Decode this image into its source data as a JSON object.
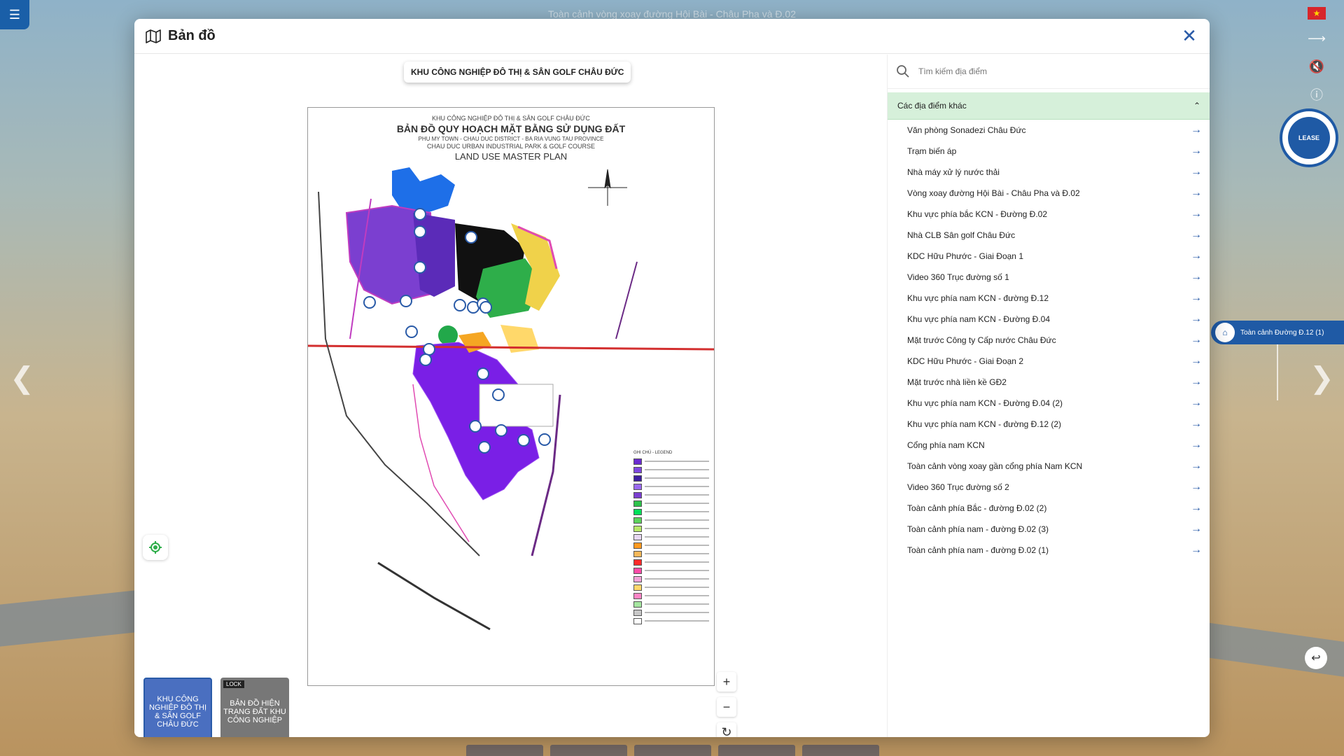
{
  "background": {
    "caption": "Toàn cảnh vòng xoay đường Hội Bài - Châu Pha và Đ.02",
    "hotspot_label": "Toàn cảnh Đường Đ.12 (1)",
    "badge_text": "LEASE"
  },
  "modal": {
    "title": "Bản đồ",
    "map_pill": "KHU CÔNG NGHIỆP ĐÔ THỊ & SÂN GOLF CHÂU ĐỨC"
  },
  "plan": {
    "line1": "KHU CÔNG NGHIỆP ĐÔ THỊ & SÂN GOLF CHÂU ĐỨC",
    "line2": "BẢN ĐỒ QUY HOẠCH MẶT BẰNG SỬ DỤNG ĐẤT",
    "line3": "PHU MY TOWN - CHAU DUC DISTRICT - BA RIA VUNG TAU PROVINCE",
    "line4": "CHAU DUC URBAN INDUSTRIAL PARK & GOLF COURSE",
    "line5": "LAND USE MASTER PLAN",
    "legend_title": "GHI CHÚ - LEGEND",
    "legend_colors": [
      "#6a2bd1",
      "#7e47e0",
      "#3d1ea0",
      "#9a6af0",
      "#7b3fd0",
      "#2ec24a",
      "#00e05a",
      "#5cd35c",
      "#b8e86a",
      "#e7d7f2",
      "#ff9a1f",
      "#f5b85a",
      "#ff2a2a",
      "#ff4aa8",
      "#f2a2d8",
      "#ffd86a",
      "#ff85c6",
      "#a5e6a0",
      "#c8c8c8",
      "#ffffff"
    ]
  },
  "thumbs": [
    {
      "label": "KHU CÔNG NGHIỆP ĐÔ THỊ & SÂN GOLF CHÂU ĐỨC"
    },
    {
      "label": "BẢN ĐỒ HIỆN TRẠNG ĐẤT KHU CÔNG NGHIỆP",
      "tag": "LOCK"
    }
  ],
  "sidebar": {
    "search_placeholder": "Tìm kiếm địa điểm",
    "group_label": "Các địa điểm khác",
    "items": [
      "Văn phòng Sonadezi Châu Đức",
      "Trạm biến áp",
      "Nhà máy xử lý nước thải",
      "Vòng xoay đường Hội Bài - Châu Pha và Đ.02",
      "Khu vực phía bắc KCN - Đường Đ.02",
      "Nhà CLB Sân golf Châu Đức",
      "KDC Hữu Phước - Giai Đoạn 1",
      "Video 360 Trục đường số 1",
      "Khu vực phía nam KCN - đường Đ.12",
      "Khu vực phía nam KCN - Đường Đ.04",
      "Mặt trước Công ty Cấp nước Châu Đức",
      "KDC Hữu Phước - Giai Đoạn 2",
      "Mặt trước nhà liền kề GĐ2",
      "Khu vực phía nam KCN - Đường Đ.04 (2)",
      "Khu vực phía nam KCN - đường Đ.12 (2)",
      "Cổng phía nam KCN",
      "Toàn cảnh vòng xoay gần cổng phía Nam KCN",
      "Video 360 Trục đường số 2",
      "Toàn cảnh phía Bắc - đường Đ.02 (2)",
      "Toàn cảnh phía nam - đường Đ.02 (3)",
      "Toàn cảnh phía nam - đường Đ.02 (1)"
    ]
  }
}
